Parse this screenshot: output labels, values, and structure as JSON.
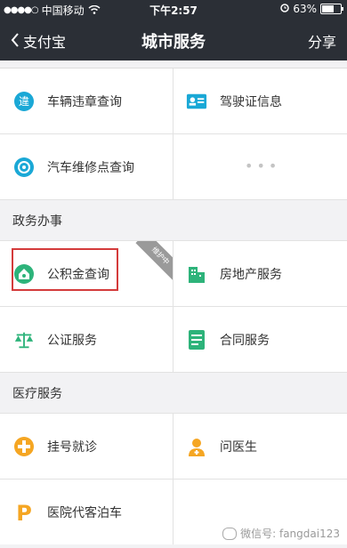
{
  "status_bar": {
    "signal_dots": "●●●●○",
    "carrier": "中国移动",
    "time": "下午2:57",
    "battery_percent": "63%",
    "battery_level": 0.63
  },
  "nav": {
    "back_label": "支付宝",
    "title": "城市服务",
    "share_label": "分享"
  },
  "sections": {
    "top": [
      [
        {
          "label": "车辆违章查询",
          "icon": "violation-icon",
          "color": "#1aa8d6"
        },
        {
          "label": "驾驶证信息",
          "icon": "license-icon",
          "color": "#1aa8d6"
        }
      ],
      [
        {
          "label": "汽车维修点查询",
          "icon": "repair-icon",
          "color": "#1aa8d6"
        },
        {
          "label": "",
          "icon": "more-dots",
          "color": "#c4c4c4"
        }
      ]
    ],
    "gov_title": "政务办事",
    "gov": [
      [
        {
          "label": "公积金查询",
          "icon": "housing-fund-icon",
          "color": "#2db37a",
          "ribbon": "维护中"
        },
        {
          "label": "房地产服务",
          "icon": "building-icon",
          "color": "#2db37a"
        }
      ],
      [
        {
          "label": "公证服务",
          "icon": "scale-icon",
          "color": "#2db37a"
        },
        {
          "label": "合同服务",
          "icon": "contract-icon",
          "color": "#2db37a"
        }
      ]
    ],
    "medical_title": "医疗服务",
    "medical": [
      [
        {
          "label": "挂号就诊",
          "icon": "medical-cross-icon",
          "color": "#f5a623"
        },
        {
          "label": "问医生",
          "icon": "doctor-icon",
          "color": "#f5a623"
        }
      ],
      [
        {
          "label": "医院代客泊车",
          "icon": "parking-icon",
          "color": "#f5a623"
        },
        {
          "label": "",
          "icon": "",
          "color": ""
        }
      ]
    ]
  },
  "watermark": "微信号: fangdai123"
}
